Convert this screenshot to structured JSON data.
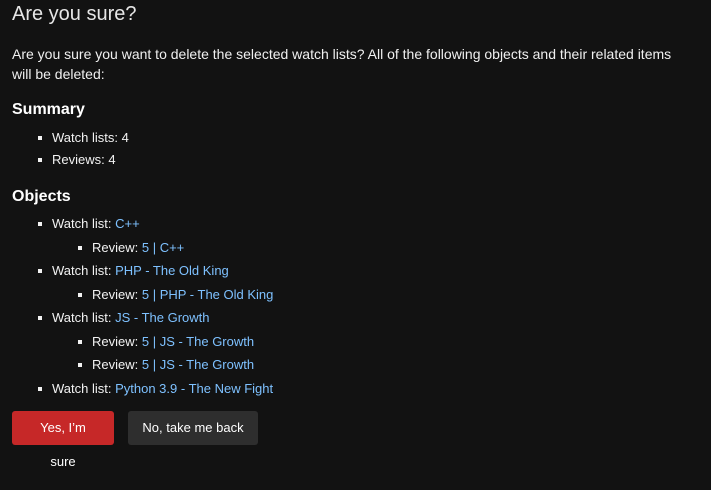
{
  "page": {
    "title": "Are you sure?",
    "intro": "Are you sure you want to delete the selected watch lists? All of the following objects and their related items will be deleted:"
  },
  "summary": {
    "heading": "Summary",
    "items": [
      "Watch lists: 4",
      "Reviews: 4"
    ]
  },
  "objects": {
    "heading": "Objects",
    "watch_list_prefix": "Watch list: ",
    "review_prefix": "Review: ",
    "items": [
      {
        "name": "C++",
        "reviews": [
          "5 | C++"
        ]
      },
      {
        "name": "PHP - The Old King",
        "reviews": [
          "5 | PHP - The Old King"
        ]
      },
      {
        "name": "JS - The Growth",
        "reviews": [
          "5 | JS - The Growth",
          "5 | JS - The Growth"
        ]
      },
      {
        "name": "Python 3.9 - The New Fight",
        "reviews": []
      }
    ]
  },
  "actions": {
    "confirm_label": "Yes, I’m sure",
    "cancel_label": "No, take me back"
  },
  "colors": {
    "background": "#121212",
    "link": "#7ec1ff",
    "danger": "#c62828",
    "secondary": "#2e2e2e"
  }
}
